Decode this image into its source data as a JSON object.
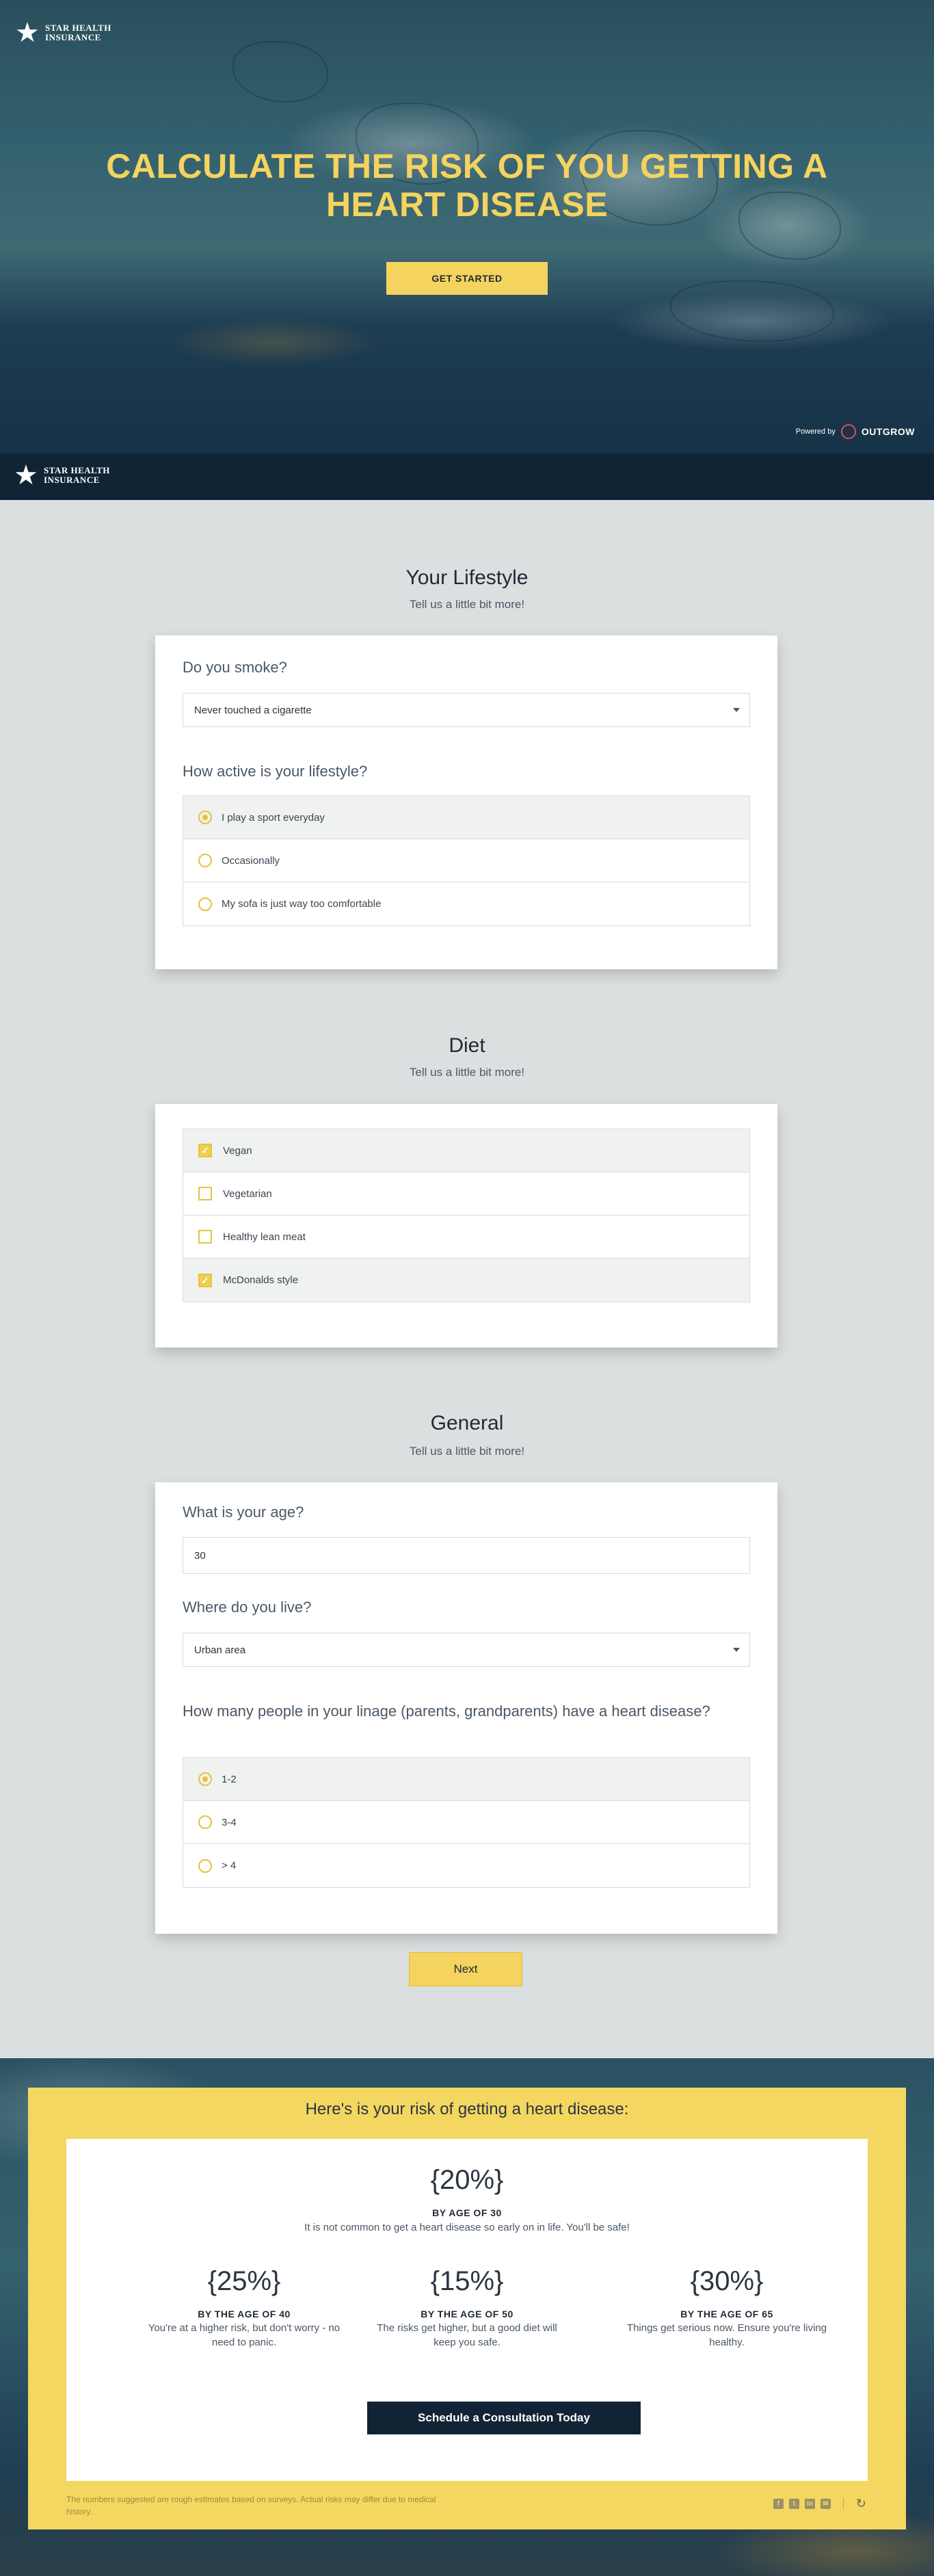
{
  "brand": {
    "line1": "STAR HEALTH",
    "line2": "INSURANCE",
    "star": "★"
  },
  "hero": {
    "title": "CALCULATE THE RISK OF YOU GETTING A HEART DISEASE",
    "cta": "GET STARTED",
    "powered_by": "Powered by",
    "powered_name": "OUTGROW"
  },
  "lifestyle": {
    "title": "Your Lifestyle",
    "subtitle": "Tell us a little bit more!",
    "q_smoke": "Do you smoke?",
    "smoke_value": "Never touched a cigarette",
    "q_active": "How active is your lifestyle?",
    "options": [
      "I play a sport everyday",
      "Occasionally",
      "My sofa is just way too comfortable"
    ],
    "selected": 0
  },
  "diet": {
    "title": "Diet",
    "subtitle": "Tell us a little bit more!",
    "options": [
      "Vegan",
      "Vegetarian",
      "Healthy lean meat",
      "McDonalds style"
    ],
    "checked": [
      true,
      false,
      false,
      true
    ],
    "check_glyph": "✓"
  },
  "general": {
    "title": "General",
    "subtitle": "Tell us a little bit more!",
    "q_age": "What is your age?",
    "age_value": "30",
    "q_live": "Where do you live?",
    "live_value": "Urban area",
    "q_linage": "How many people in your linage (parents, grandparents) have a heart disease?",
    "options": [
      "1-2",
      "3-4",
      "> 4"
    ],
    "selected": 0
  },
  "next_label": "Next",
  "result": {
    "title": "Here's is your risk of getting a heart disease:",
    "main": {
      "pct": "{20%}",
      "age": "BY AGE OF 30",
      "desc": "It is not common to get a heart disease so early on in life. You'll be safe!"
    },
    "items": [
      {
        "pct": "{25%}",
        "age": "BY THE AGE OF 40",
        "desc": "You're at a higher risk, but don't worry - no need to panic."
      },
      {
        "pct": "{15%}",
        "age": "BY THE AGE OF 50",
        "desc": "The risks get higher, but a good diet will keep you safe."
      },
      {
        "pct": "{30%}",
        "age": "BY THE AGE OF 65",
        "desc": "Things get serious now. Ensure you're living healthy."
      }
    ],
    "schedule": "Schedule a Consultation Today",
    "disclaimer": "The numbers suggested are rough estimates based on surveys. Actual risks may differ due to medical history.",
    "share_icons": [
      "facebook-icon",
      "twitter-icon",
      "linkedin-icon",
      "email-icon"
    ],
    "share_glyphs": [
      "f",
      "t",
      "in",
      "✉"
    ],
    "redo_glyph": "↻"
  },
  "colors": {
    "accent": "#f4d35e",
    "navy": "#112436",
    "page_bg": "#dcdfe0"
  }
}
